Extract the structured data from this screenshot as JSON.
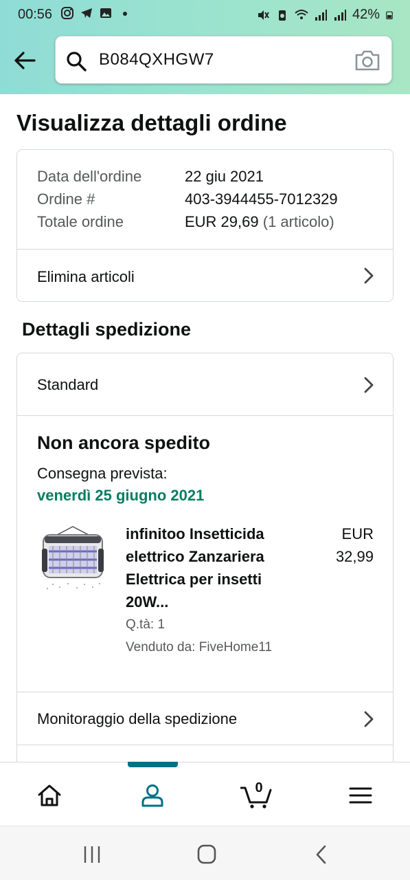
{
  "status_bar": {
    "time": "00:56",
    "battery": "42%",
    "left_icons": [
      "instagram-icon",
      "telegram-icon",
      "gallery-icon",
      "dot-icon"
    ],
    "right_icons": [
      "mute-icon",
      "recycle-icon",
      "wifi-icon",
      "signal-icon",
      "signal-icon",
      "battery-icon"
    ]
  },
  "search": {
    "query": "B084QXHGW7"
  },
  "page": {
    "title": "Visualizza dettagli ordine"
  },
  "order_summary": {
    "date_label": "Data dell'ordine",
    "date_value": "22 giu 2021",
    "order_label": "Ordine #",
    "order_value": "403-3944455-7012329",
    "total_label": "Totale ordine",
    "total_value": "EUR 29,69",
    "total_items": "(1 articolo)",
    "delete_items_label": "Elimina articoli"
  },
  "shipping": {
    "section_title": "Dettagli spedizione",
    "method": "Standard",
    "status_title": "Non ancora spedito",
    "delivery_label": "Consegna prevista:",
    "delivery_date": "venerdì 25 giugno 2021",
    "product": {
      "title": "infinitoo Insetticida elettrico Zanzariera Elettrica per insetti 20W...",
      "price_currency": "EUR",
      "price_value": "32,99",
      "qty": "Q.tà: 1",
      "seller": "Venduto da: FiveHome11"
    },
    "tracking_label": "Monitoraggio della spedizione"
  },
  "bottom_nav": {
    "cart_count": "0",
    "items": [
      "home-icon",
      "account-icon",
      "cart-icon",
      "menu-icon"
    ],
    "active": "account-icon",
    "accent_color": "#007185"
  },
  "colors": {
    "delivery_green": "#067d62",
    "header_gradient_start": "#8fdcd6",
    "header_gradient_end": "#a8e6c4"
  }
}
